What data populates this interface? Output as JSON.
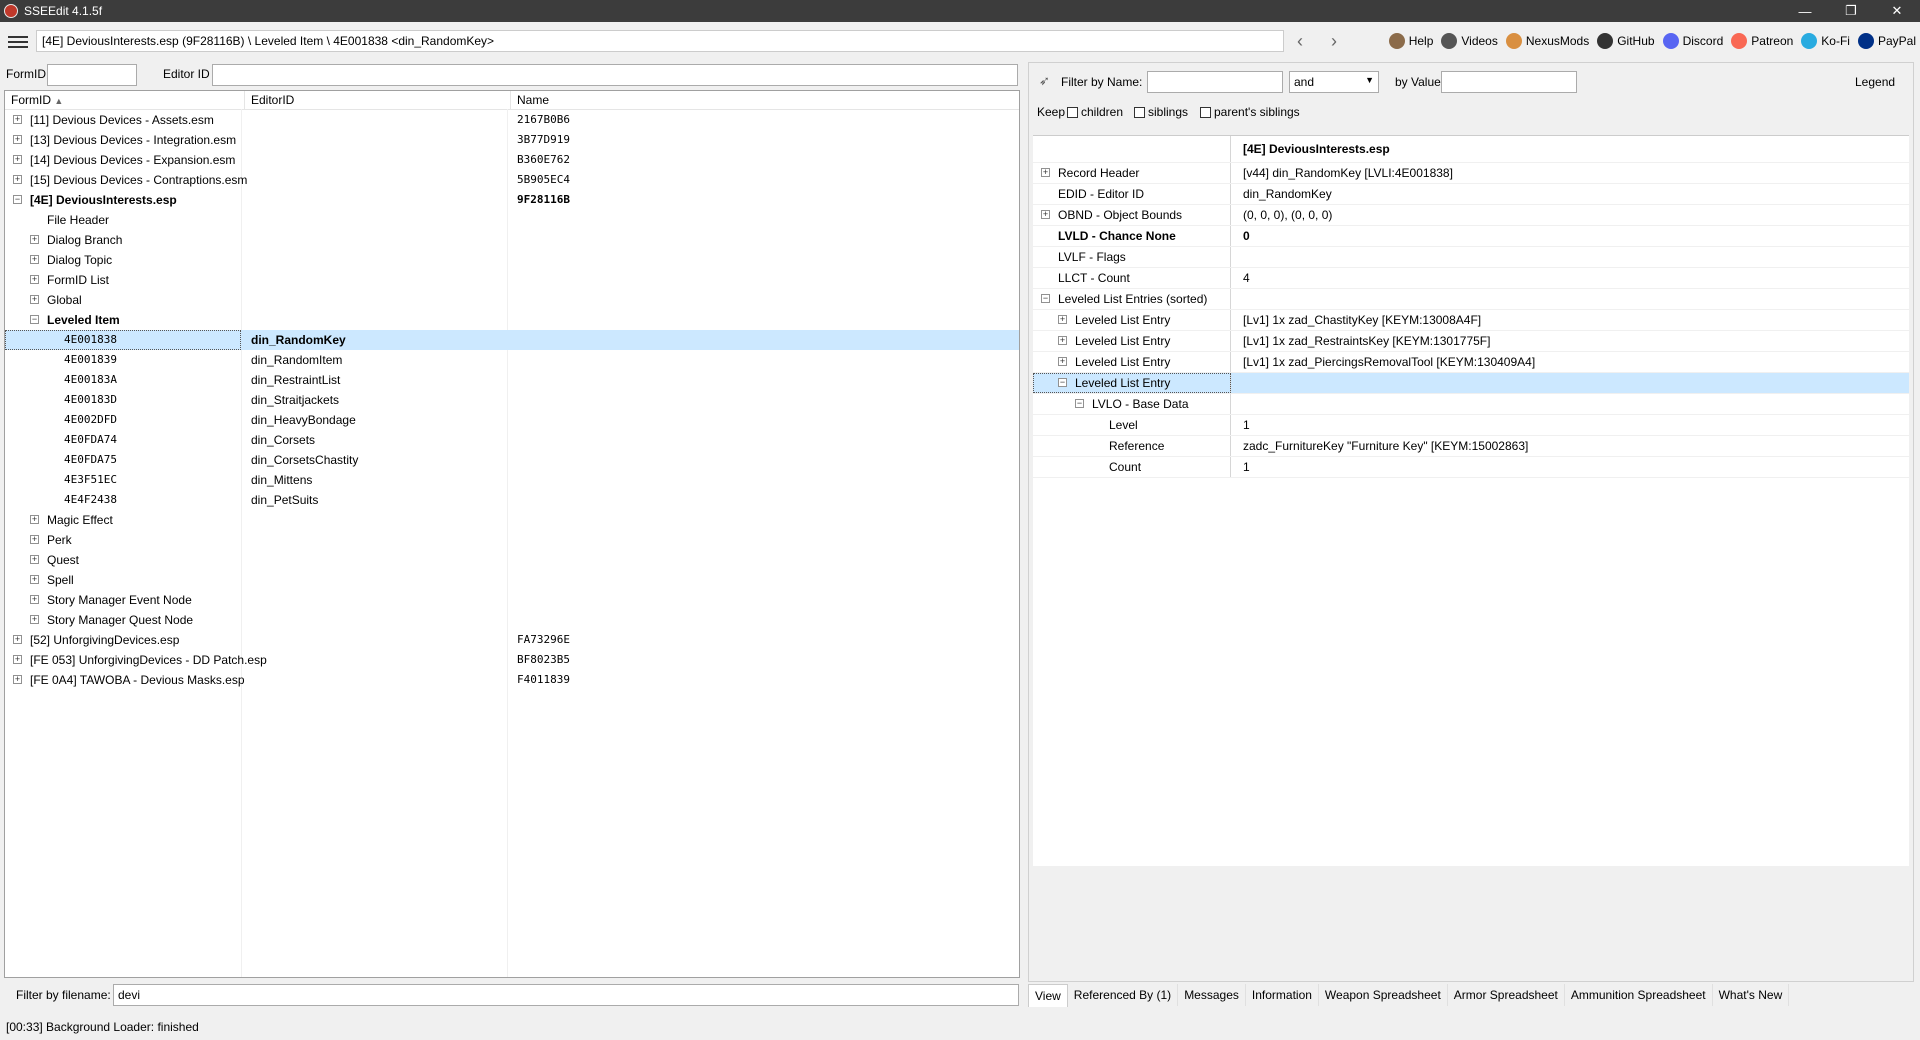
{
  "window": {
    "title": "SSEEdit 4.1.5f"
  },
  "toolbar": {
    "path": "[4E] DeviousInterests.esp (9F28116B) \\ Leveled Item \\ 4E001838 <din_RandomKey>",
    "links": [
      {
        "label": "Help",
        "icon": "book-icon",
        "color": "#8b6b4a"
      },
      {
        "label": "Videos",
        "icon": "videos-icon",
        "color": "#555555"
      },
      {
        "label": "NexusMods",
        "icon": "nexusmods-icon",
        "color": "#d98f40"
      },
      {
        "label": "GitHub",
        "icon": "github-icon",
        "color": "#333333"
      },
      {
        "label": "Discord",
        "icon": "discord-icon",
        "color": "#5865f2"
      },
      {
        "label": "Patreon",
        "icon": "patreon-icon",
        "color": "#f96854"
      },
      {
        "label": "Ko-Fi",
        "icon": "kofi-icon",
        "color": "#29abe0"
      },
      {
        "label": "PayPal",
        "icon": "paypal-icon",
        "color": "#003087"
      }
    ]
  },
  "left": {
    "formid_label": "FormID",
    "formid_value": "",
    "editorid_label": "Editor ID",
    "editorid_value": "",
    "columns": [
      "FormID",
      "EditorID",
      "Name"
    ],
    "rows": [
      {
        "depth": 0,
        "exp": "+",
        "c1": "[11] Devious Devices - Assets.esm",
        "c2": "",
        "c3": "2167B0B6",
        "bold": false
      },
      {
        "depth": 0,
        "exp": "+",
        "c1": "[13] Devious Devices - Integration.esm",
        "c2": "",
        "c3": "3B77D919",
        "bold": false
      },
      {
        "depth": 0,
        "exp": "+",
        "c1": "[14] Devious Devices - Expansion.esm",
        "c2": "",
        "c3": "B360E762",
        "bold": false
      },
      {
        "depth": 0,
        "exp": "+",
        "c1": "[15] Devious Devices - Contraptions.esm",
        "c2": "",
        "c3": "5B905EC4",
        "bold": false
      },
      {
        "depth": 0,
        "exp": "-",
        "c1": "[4E] DeviousInterests.esp",
        "c2": "",
        "c3": "9F28116B",
        "bold": true
      },
      {
        "depth": 1,
        "exp": "",
        "c1": "File Header",
        "c2": "",
        "c3": "",
        "bold": false
      },
      {
        "depth": 1,
        "exp": "+",
        "c1": "Dialog Branch",
        "c2": "",
        "c3": "",
        "bold": false
      },
      {
        "depth": 1,
        "exp": "+",
        "c1": "Dialog Topic",
        "c2": "",
        "c3": "",
        "bold": false
      },
      {
        "depth": 1,
        "exp": "+",
        "c1": "FormID List",
        "c2": "",
        "c3": "",
        "bold": false
      },
      {
        "depth": 1,
        "exp": "+",
        "c1": "Global",
        "c2": "",
        "c3": "",
        "bold": false
      },
      {
        "depth": 1,
        "exp": "-",
        "c1": "Leveled Item",
        "c2": "",
        "c3": "",
        "bold": true
      },
      {
        "depth": 2,
        "exp": "",
        "c1": "4E001838",
        "c2": "din_RandomKey",
        "c3": "",
        "bold": false,
        "selected": true,
        "mono": true
      },
      {
        "depth": 2,
        "exp": "",
        "c1": "4E001839",
        "c2": "din_RandomItem",
        "c3": "",
        "bold": false,
        "mono": true
      },
      {
        "depth": 2,
        "exp": "",
        "c1": "4E00183A",
        "c2": "din_RestraintList",
        "c3": "",
        "bold": false,
        "mono": true
      },
      {
        "depth": 2,
        "exp": "",
        "c1": "4E00183D",
        "c2": "din_Straitjackets",
        "c3": "",
        "bold": false,
        "mono": true
      },
      {
        "depth": 2,
        "exp": "",
        "c1": "4E002DFD",
        "c2": "din_HeavyBondage",
        "c3": "",
        "bold": false,
        "mono": true
      },
      {
        "depth": 2,
        "exp": "",
        "c1": "4E0FDA74",
        "c2": "din_Corsets",
        "c3": "",
        "bold": false,
        "mono": true
      },
      {
        "depth": 2,
        "exp": "",
        "c1": "4E0FDA75",
        "c2": "din_CorsetsChastity",
        "c3": "",
        "bold": false,
        "mono": true
      },
      {
        "depth": 2,
        "exp": "",
        "c1": "4E3F51EC",
        "c2": "din_Mittens",
        "c3": "",
        "bold": false,
        "mono": true
      },
      {
        "depth": 2,
        "exp": "",
        "c1": "4E4F2438",
        "c2": "din_PetSuits",
        "c3": "",
        "bold": false,
        "mono": true
      },
      {
        "depth": 1,
        "exp": "+",
        "c1": "Magic Effect",
        "c2": "",
        "c3": "",
        "bold": false
      },
      {
        "depth": 1,
        "exp": "+",
        "c1": "Perk",
        "c2": "",
        "c3": "",
        "bold": false
      },
      {
        "depth": 1,
        "exp": "+",
        "c1": "Quest",
        "c2": "",
        "c3": "",
        "bold": false
      },
      {
        "depth": 1,
        "exp": "+",
        "c1": "Spell",
        "c2": "",
        "c3": "",
        "bold": false
      },
      {
        "depth": 1,
        "exp": "+",
        "c1": "Story Manager Event Node",
        "c2": "",
        "c3": "",
        "bold": false
      },
      {
        "depth": 1,
        "exp": "+",
        "c1": "Story Manager Quest Node",
        "c2": "",
        "c3": "",
        "bold": false
      },
      {
        "depth": 0,
        "exp": "+",
        "c1": "[52] UnforgivingDevices.esp",
        "c2": "",
        "c3": "FA73296E",
        "bold": false
      },
      {
        "depth": 0,
        "exp": "+",
        "c1": "[FE 053] UnforgivingDevices - DD Patch.esp",
        "c2": "",
        "c3": "BF8023B5",
        "bold": false
      },
      {
        "depth": 0,
        "exp": "+",
        "c1": "[FE 0A4] TAWOBA - Devious Masks.esp",
        "c2": "",
        "c3": "F4011839",
        "bold": false
      }
    ],
    "filter_label": "Filter by filename:",
    "filter_value": "devi"
  },
  "right": {
    "filter_name_label": "Filter by Name:",
    "filter_name_value": "",
    "and_select": "and",
    "by_value_label": "by Value:",
    "by_value_value": "",
    "legend": "Legend",
    "keep_label": "Keep",
    "keep_children": "children",
    "keep_siblings": "siblings",
    "keep_parents_siblings": "parent's siblings",
    "column_header": "[4E] DeviousInterests.esp",
    "rows": [
      {
        "depth": 0,
        "exp": "+",
        "label": "Record Header",
        "value": "[v44] din_RandomKey [LVLI:4E001838]",
        "bold": false
      },
      {
        "depth": 0,
        "exp": "",
        "label": "EDID - Editor ID",
        "value": "din_RandomKey",
        "bold": false
      },
      {
        "depth": 0,
        "exp": "+",
        "label": "OBND - Object Bounds",
        "value": "(0, 0, 0), (0, 0, 0)",
        "bold": false
      },
      {
        "depth": 0,
        "exp": "",
        "label": "LVLD - Chance None",
        "value": "0",
        "bold": true
      },
      {
        "depth": 0,
        "exp": "",
        "label": "LVLF - Flags",
        "value": "",
        "bold": false
      },
      {
        "depth": 0,
        "exp": "",
        "label": "LLCT - Count",
        "value": "4",
        "bold": false
      },
      {
        "depth": 0,
        "exp": "-",
        "label": "Leveled List Entries (sorted)",
        "value": "",
        "bold": false
      },
      {
        "depth": 1,
        "exp": "+",
        "label": "Leveled List Entry",
        "value": "[Lv1] 1x zad_ChastityKey [KEYM:13008A4F]",
        "bold": false
      },
      {
        "depth": 1,
        "exp": "+",
        "label": "Leveled List Entry",
        "value": "[Lv1] 1x zad_RestraintsKey [KEYM:1301775F]",
        "bold": false
      },
      {
        "depth": 1,
        "exp": "+",
        "label": "Leveled List Entry",
        "value": "[Lv1] 1x zad_PiercingsRemovalTool [KEYM:130409A4]",
        "bold": false
      },
      {
        "depth": 1,
        "exp": "-",
        "label": "Leveled List Entry",
        "value": "",
        "bold": false,
        "selected": true
      },
      {
        "depth": 2,
        "exp": "-",
        "label": "LVLO - Base Data",
        "value": "",
        "bold": false
      },
      {
        "depth": 3,
        "exp": "",
        "label": "Level",
        "value": "1",
        "bold": false
      },
      {
        "depth": 3,
        "exp": "",
        "label": "Reference",
        "value": "zadc_FurnitureKey \"Furniture Key\" [KEYM:15002863]",
        "bold": false
      },
      {
        "depth": 3,
        "exp": "",
        "label": "Count",
        "value": "1",
        "bold": false
      }
    ],
    "tabs": [
      "View",
      "Referenced By (1)",
      "Messages",
      "Information",
      "Weapon Spreadsheet",
      "Armor Spreadsheet",
      "Ammunition Spreadsheet",
      "What's New"
    ]
  },
  "status": {
    "text": "[00:33] Background Loader: finished"
  }
}
